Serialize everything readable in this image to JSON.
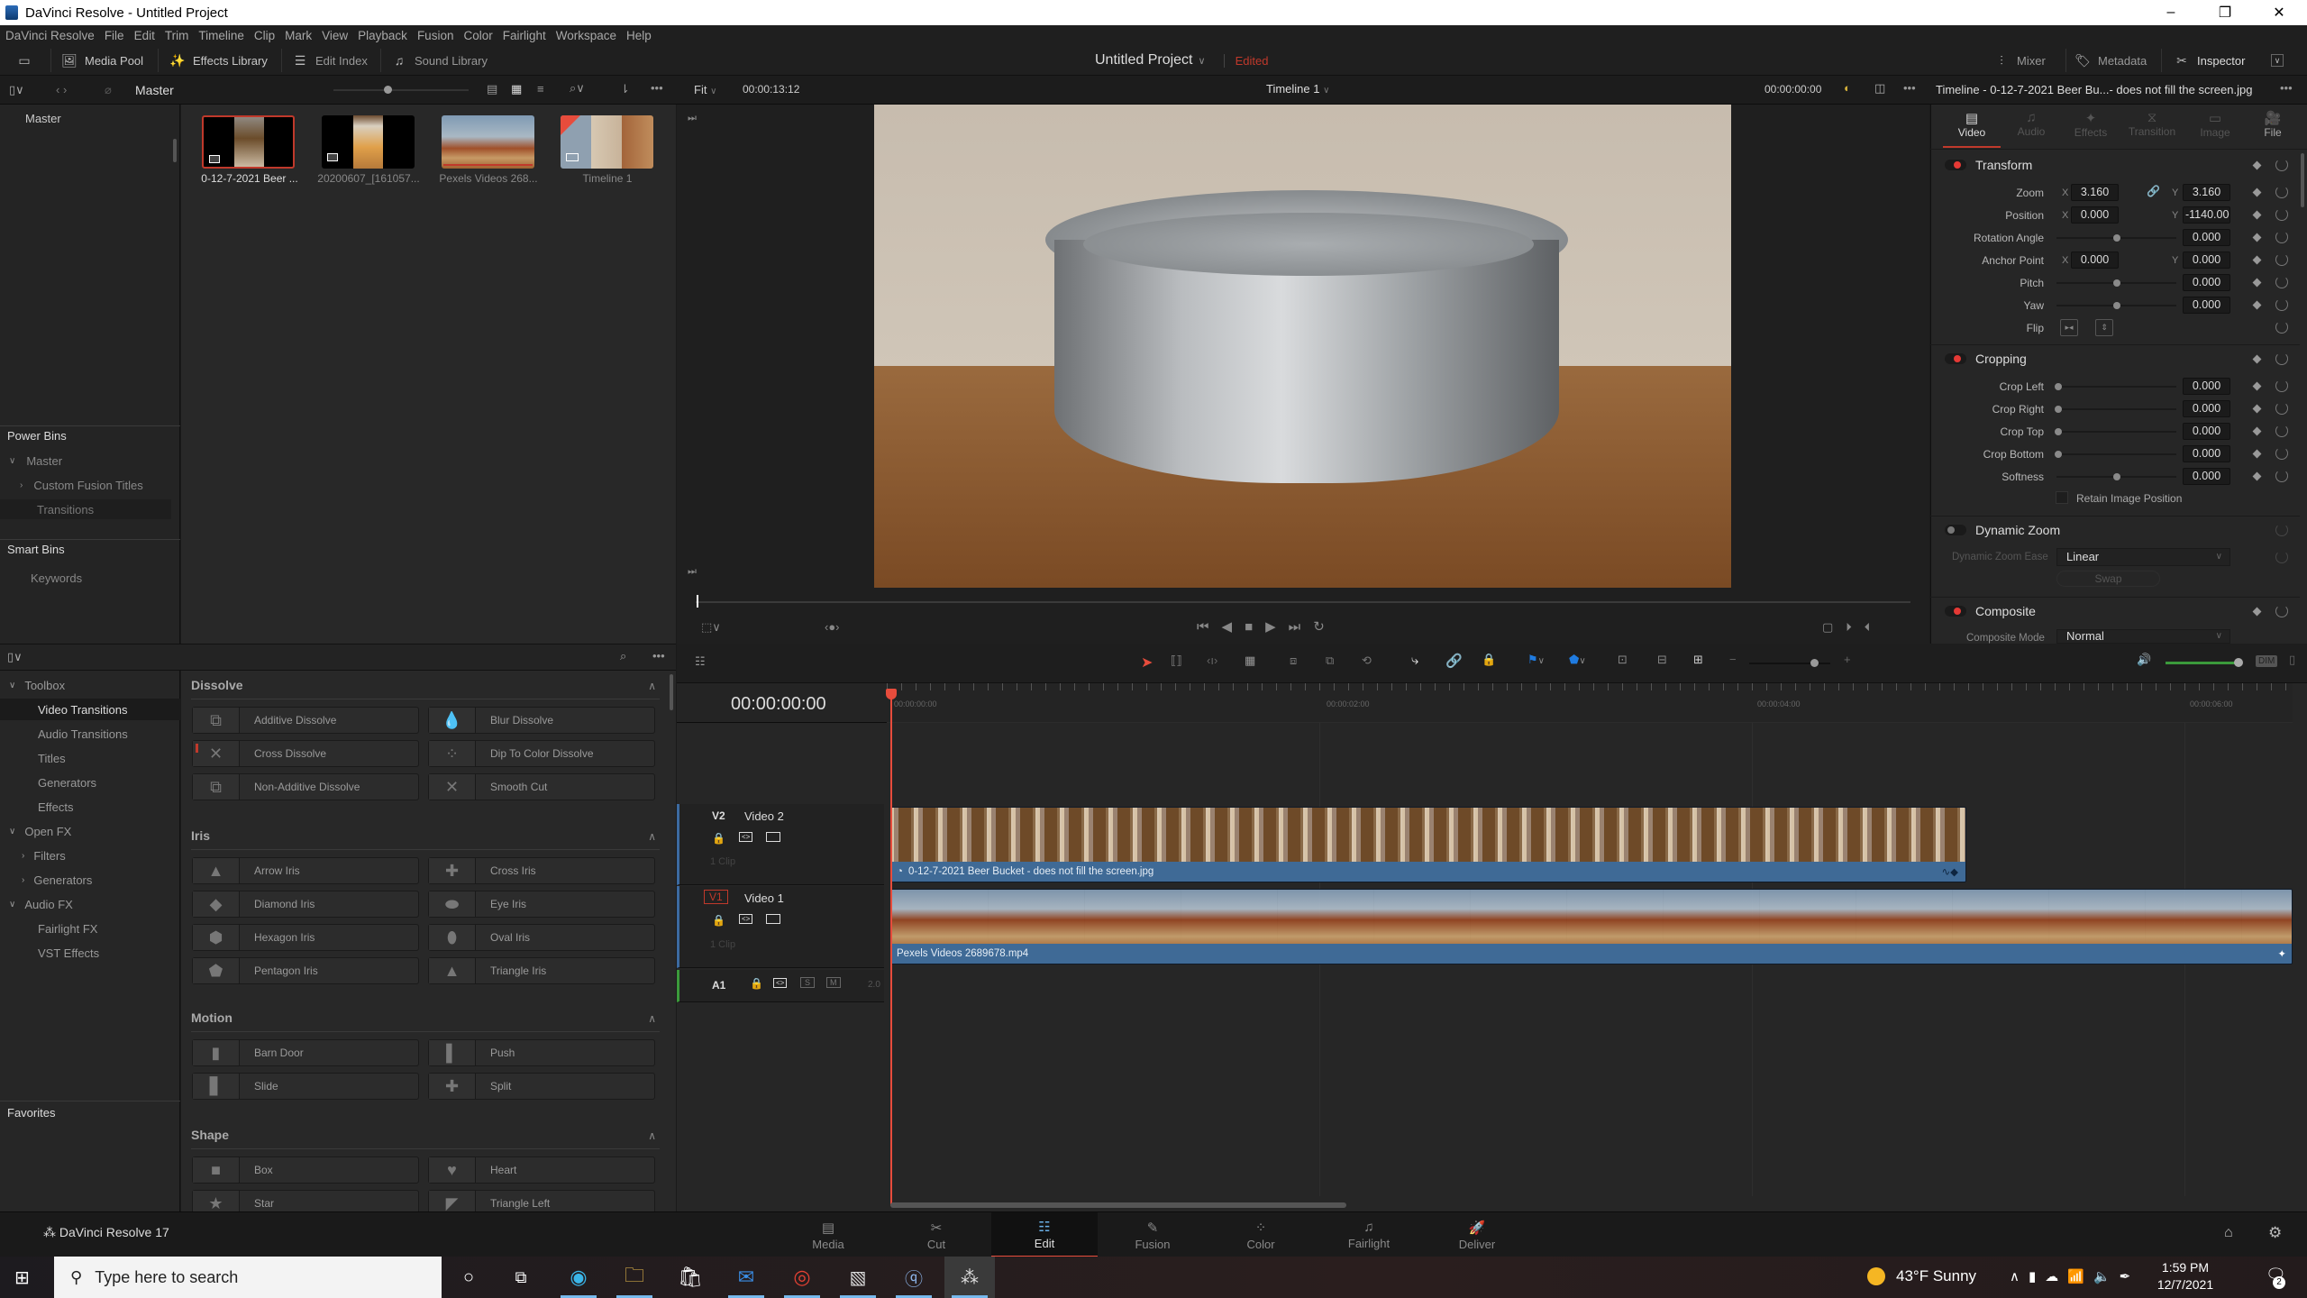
{
  "window": {
    "title": "DaVinci Resolve - Untitled Project",
    "minimize": "–",
    "maximize": "❐",
    "close": "✕"
  },
  "menu": [
    "DaVinci Resolve",
    "File",
    "Edit",
    "Trim",
    "Timeline",
    "Clip",
    "Mark",
    "View",
    "Playback",
    "Fusion",
    "Color",
    "Fairlight",
    "Workspace",
    "Help"
  ],
  "toolbar": {
    "media_pool": "Media Pool",
    "effects_library": "Effects Library",
    "edit_index": "Edit Index",
    "sound_library": "Sound Library",
    "project_title": "Untitled Project",
    "project_status": "Edited",
    "mixer": "Mixer",
    "metadata": "Metadata",
    "inspector": "Inspector"
  },
  "subbar": {
    "bin_title": "Master",
    "viewer_fit": "Fit",
    "source_timecode": "00:00:13:12",
    "timeline_name": "Timeline 1",
    "record_timecode": "00:00:00:00",
    "inspector_title": "Timeline - 0-12-7-2021 Beer Bu...- does not fill the screen.jpg"
  },
  "bins": {
    "master": "Master",
    "power_bins_title": "Power Bins",
    "power_bins": [
      {
        "label": "Master",
        "expanded": true
      },
      {
        "label": "Custom Fusion Titles",
        "expanded": false
      },
      {
        "label": "Transitions"
      }
    ],
    "smart_bins_title": "Smart Bins",
    "smart_bins": [
      "Keywords"
    ]
  },
  "media_pool": [
    {
      "label": "0-12-7-2021 Beer ...",
      "type": "image",
      "selected": true
    },
    {
      "label": "20200607_[161057...",
      "type": "image"
    },
    {
      "label": "Pexels Videos 268...",
      "type": "video"
    },
    {
      "label": "Timeline 1",
      "type": "timeline",
      "checked": true
    }
  ],
  "inspector": {
    "tabs": [
      {
        "label": "Video",
        "active": true
      },
      {
        "label": "Audio"
      },
      {
        "label": "Effects"
      },
      {
        "label": "Transition"
      },
      {
        "label": "Image"
      },
      {
        "label": "File"
      }
    ],
    "transform": {
      "title": "Transform",
      "zoom": {
        "label": "Zoom",
        "x": "3.160",
        "y": "3.160"
      },
      "position": {
        "label": "Position",
        "x": "0.000",
        "y": "-1140.000"
      },
      "rotation": {
        "label": "Rotation Angle",
        "value": "0.000"
      },
      "anchor": {
        "label": "Anchor Point",
        "x": "0.000",
        "y": "0.000"
      },
      "pitch": {
        "label": "Pitch",
        "value": "0.000"
      },
      "yaw": {
        "label": "Yaw",
        "value": "0.000"
      },
      "flip": {
        "label": "Flip"
      }
    },
    "cropping": {
      "title": "Cropping",
      "crop_left": {
        "label": "Crop Left",
        "value": "0.000"
      },
      "crop_right": {
        "label": "Crop Right",
        "value": "0.000"
      },
      "crop_top": {
        "label": "Crop Top",
        "value": "0.000"
      },
      "crop_bottom": {
        "label": "Crop Bottom",
        "value": "0.000"
      },
      "softness": {
        "label": "Softness",
        "value": "0.000"
      },
      "retain": "Retain Image Position"
    },
    "dynamic_zoom": {
      "title": "Dynamic Zoom",
      "ease_label": "Dynamic Zoom Ease",
      "ease_value": "Linear",
      "swap": "Swap"
    },
    "composite": {
      "title": "Composite",
      "mode_label": "Composite Mode",
      "mode_value": "Normal"
    },
    "axis_x": "X",
    "axis_y": "Y"
  },
  "effects": {
    "tree": [
      {
        "label": "Toolbox",
        "level": 0,
        "expand": "v"
      },
      {
        "label": "Video Transitions",
        "level": 1,
        "selected": true
      },
      {
        "label": "Audio Transitions",
        "level": 1
      },
      {
        "label": "Titles",
        "level": 1
      },
      {
        "label": "Generators",
        "level": 1
      },
      {
        "label": "Effects",
        "level": 1
      },
      {
        "label": "Open FX",
        "level": 0,
        "expand": "v"
      },
      {
        "label": "Filters",
        "level": 1,
        "expand": ">"
      },
      {
        "label": "Generators",
        "level": 1,
        "expand": ">"
      },
      {
        "label": "Audio FX",
        "level": 0,
        "expand": "v"
      },
      {
        "label": "Fairlight FX",
        "level": 1
      },
      {
        "label": "VST Effects",
        "level": 1
      }
    ],
    "favorites": "Favorites",
    "groups": [
      {
        "title": "Dissolve",
        "items": [
          "Additive Dissolve",
          "Blur Dissolve",
          "Cross Dissolve",
          "Dip To Color Dissolve",
          "Non-Additive Dissolve",
          "Smooth Cut"
        ]
      },
      {
        "title": "Iris",
        "items": [
          "Arrow Iris",
          "Cross Iris",
          "Diamond Iris",
          "Eye Iris",
          "Hexagon Iris",
          "Oval Iris",
          "Pentagon Iris",
          "Triangle Iris"
        ]
      },
      {
        "title": "Motion",
        "items": [
          "Barn Door",
          "Push",
          "Slide",
          "Split"
        ]
      },
      {
        "title": "Shape",
        "items": [
          "Box",
          "Heart",
          "Star",
          "Triangle Left"
        ]
      }
    ]
  },
  "timeline": {
    "timecode": "00:00:00:00",
    "ruler": [
      "00:00:00:00",
      "00:00:02:00",
      "00:00:04:00",
      "00:00:06:00"
    ],
    "tracks": [
      {
        "id": "V2",
        "name": "Video 2",
        "clips": "1 Clip",
        "clip_label": "0-12-7-2021 Beer Bucket - does not fill the screen.jpg"
      },
      {
        "id": "V1",
        "name": "Video 1",
        "clips": "1 Clip",
        "clip_label": "Pexels Videos 2689678.mp4"
      },
      {
        "id": "A1",
        "name": "",
        "channels": "2.0",
        "solo": "S",
        "mute": "M"
      }
    ],
    "dim": "DIM"
  },
  "pages": [
    {
      "label": "Media"
    },
    {
      "label": "Cut"
    },
    {
      "label": "Edit",
      "active": true
    },
    {
      "label": "Fusion"
    },
    {
      "label": "Color"
    },
    {
      "label": "Fairlight"
    },
    {
      "label": "Deliver"
    }
  ],
  "brand": "DaVinci Resolve 17",
  "taskbar": {
    "search_placeholder": "Type here to search",
    "weather": "43°F  Sunny",
    "time": "1:59 PM",
    "date": "12/7/2021",
    "notifications": "2"
  }
}
